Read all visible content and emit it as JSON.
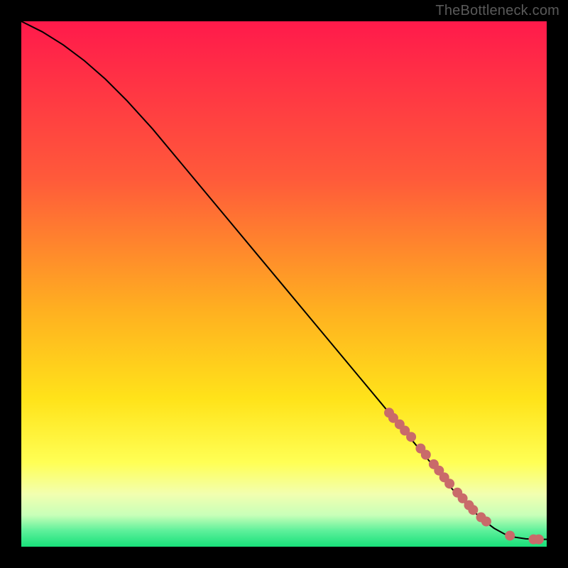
{
  "watermark": "TheBottleneck.com",
  "colors": {
    "bg_black": "#000000",
    "line": "#000000",
    "marker_fill": "#c96a6a",
    "gradient_stops": [
      {
        "pos": 0.0,
        "color": "#ff1a4b"
      },
      {
        "pos": 0.3,
        "color": "#ff5a3a"
      },
      {
        "pos": 0.55,
        "color": "#ffb020"
      },
      {
        "pos": 0.72,
        "color": "#ffe31a"
      },
      {
        "pos": 0.84,
        "color": "#ffff55"
      },
      {
        "pos": 0.9,
        "color": "#f2ffb0"
      },
      {
        "pos": 0.94,
        "color": "#c8ffb8"
      },
      {
        "pos": 0.97,
        "color": "#5cf09a"
      },
      {
        "pos": 1.0,
        "color": "#18e07a"
      }
    ]
  },
  "chart_data": {
    "type": "line",
    "title": "",
    "xlabel": "",
    "ylabel": "",
    "xlim": [
      0,
      100
    ],
    "ylim": [
      0,
      100
    ],
    "series": [
      {
        "name": "curve",
        "x": [
          0,
          4,
          8,
          12,
          16,
          20,
          25,
          30,
          35,
          40,
          45,
          50,
          55,
          60,
          65,
          70,
          75,
          80,
          82,
          84,
          86,
          88,
          90,
          92,
          94,
          96,
          98,
          100
        ],
        "y": [
          100,
          98,
          95.5,
          92.5,
          89,
          85,
          79.5,
          73.5,
          67.5,
          61.5,
          55.5,
          49.5,
          43.5,
          37.5,
          31.5,
          25.5,
          19.5,
          13.5,
          11,
          8.8,
          6.8,
          5.0,
          3.5,
          2.4,
          1.8,
          1.5,
          1.4,
          1.4
        ]
      }
    ],
    "markers": {
      "name": "highlighted-points",
      "x": [
        70.0,
        70.8,
        72.0,
        73.0,
        74.2,
        76.0,
        77.0,
        78.5,
        79.5,
        80.5,
        81.5,
        83.0,
        84.0,
        85.2,
        86.0,
        87.5,
        88.5,
        93.0,
        97.5,
        98.5
      ],
      "y": [
        25.5,
        24.5,
        23.3,
        22.1,
        20.9,
        18.7,
        17.5,
        15.7,
        14.5,
        13.2,
        12.0,
        10.3,
        9.2,
        7.9,
        7.0,
        5.6,
        4.8,
        2.1,
        1.4,
        1.4
      ]
    }
  }
}
